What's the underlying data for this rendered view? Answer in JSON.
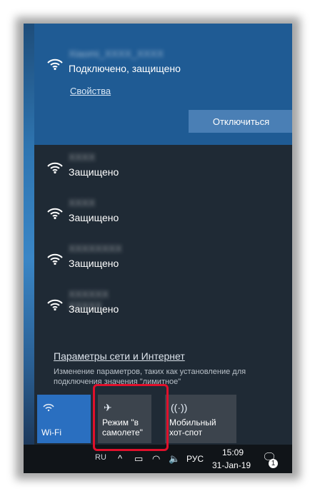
{
  "connected_network": {
    "name": "Xiaomi_XXXX_XXXX",
    "status": "Подключено, защищено",
    "properties_link": "Свойства",
    "disconnect_button": "Отключиться"
  },
  "networks": [
    {
      "name": "XXXX",
      "status": "Защищено"
    },
    {
      "name": "XXXX",
      "status": "Защищено"
    },
    {
      "name": "XXXXXXXX",
      "status": "Защищено"
    },
    {
      "name": "XXXXXX XXXXX",
      "status": "Защищено"
    }
  ],
  "settings": {
    "link": "Параметры сети и Интернет",
    "description": "Изменение параметров, таких как установление для подключения значения \"лимитное\""
  },
  "quick_actions": {
    "wifi_label": "Wi-Fi",
    "airplane_label_line1": "Режим \"в",
    "airplane_label_line2": "самолете\"",
    "hotspot_label_line1": "Мобильный",
    "hotspot_label_line2": "хот-спот"
  },
  "taskbar": {
    "language_small": "RU",
    "language": "РУС",
    "time": "15:09",
    "date": "31-Jan-19",
    "notification_count": "1"
  },
  "colors": {
    "accent": "#1f5b94",
    "tile_active": "#2a6fc0",
    "highlight": "#e0102b"
  }
}
